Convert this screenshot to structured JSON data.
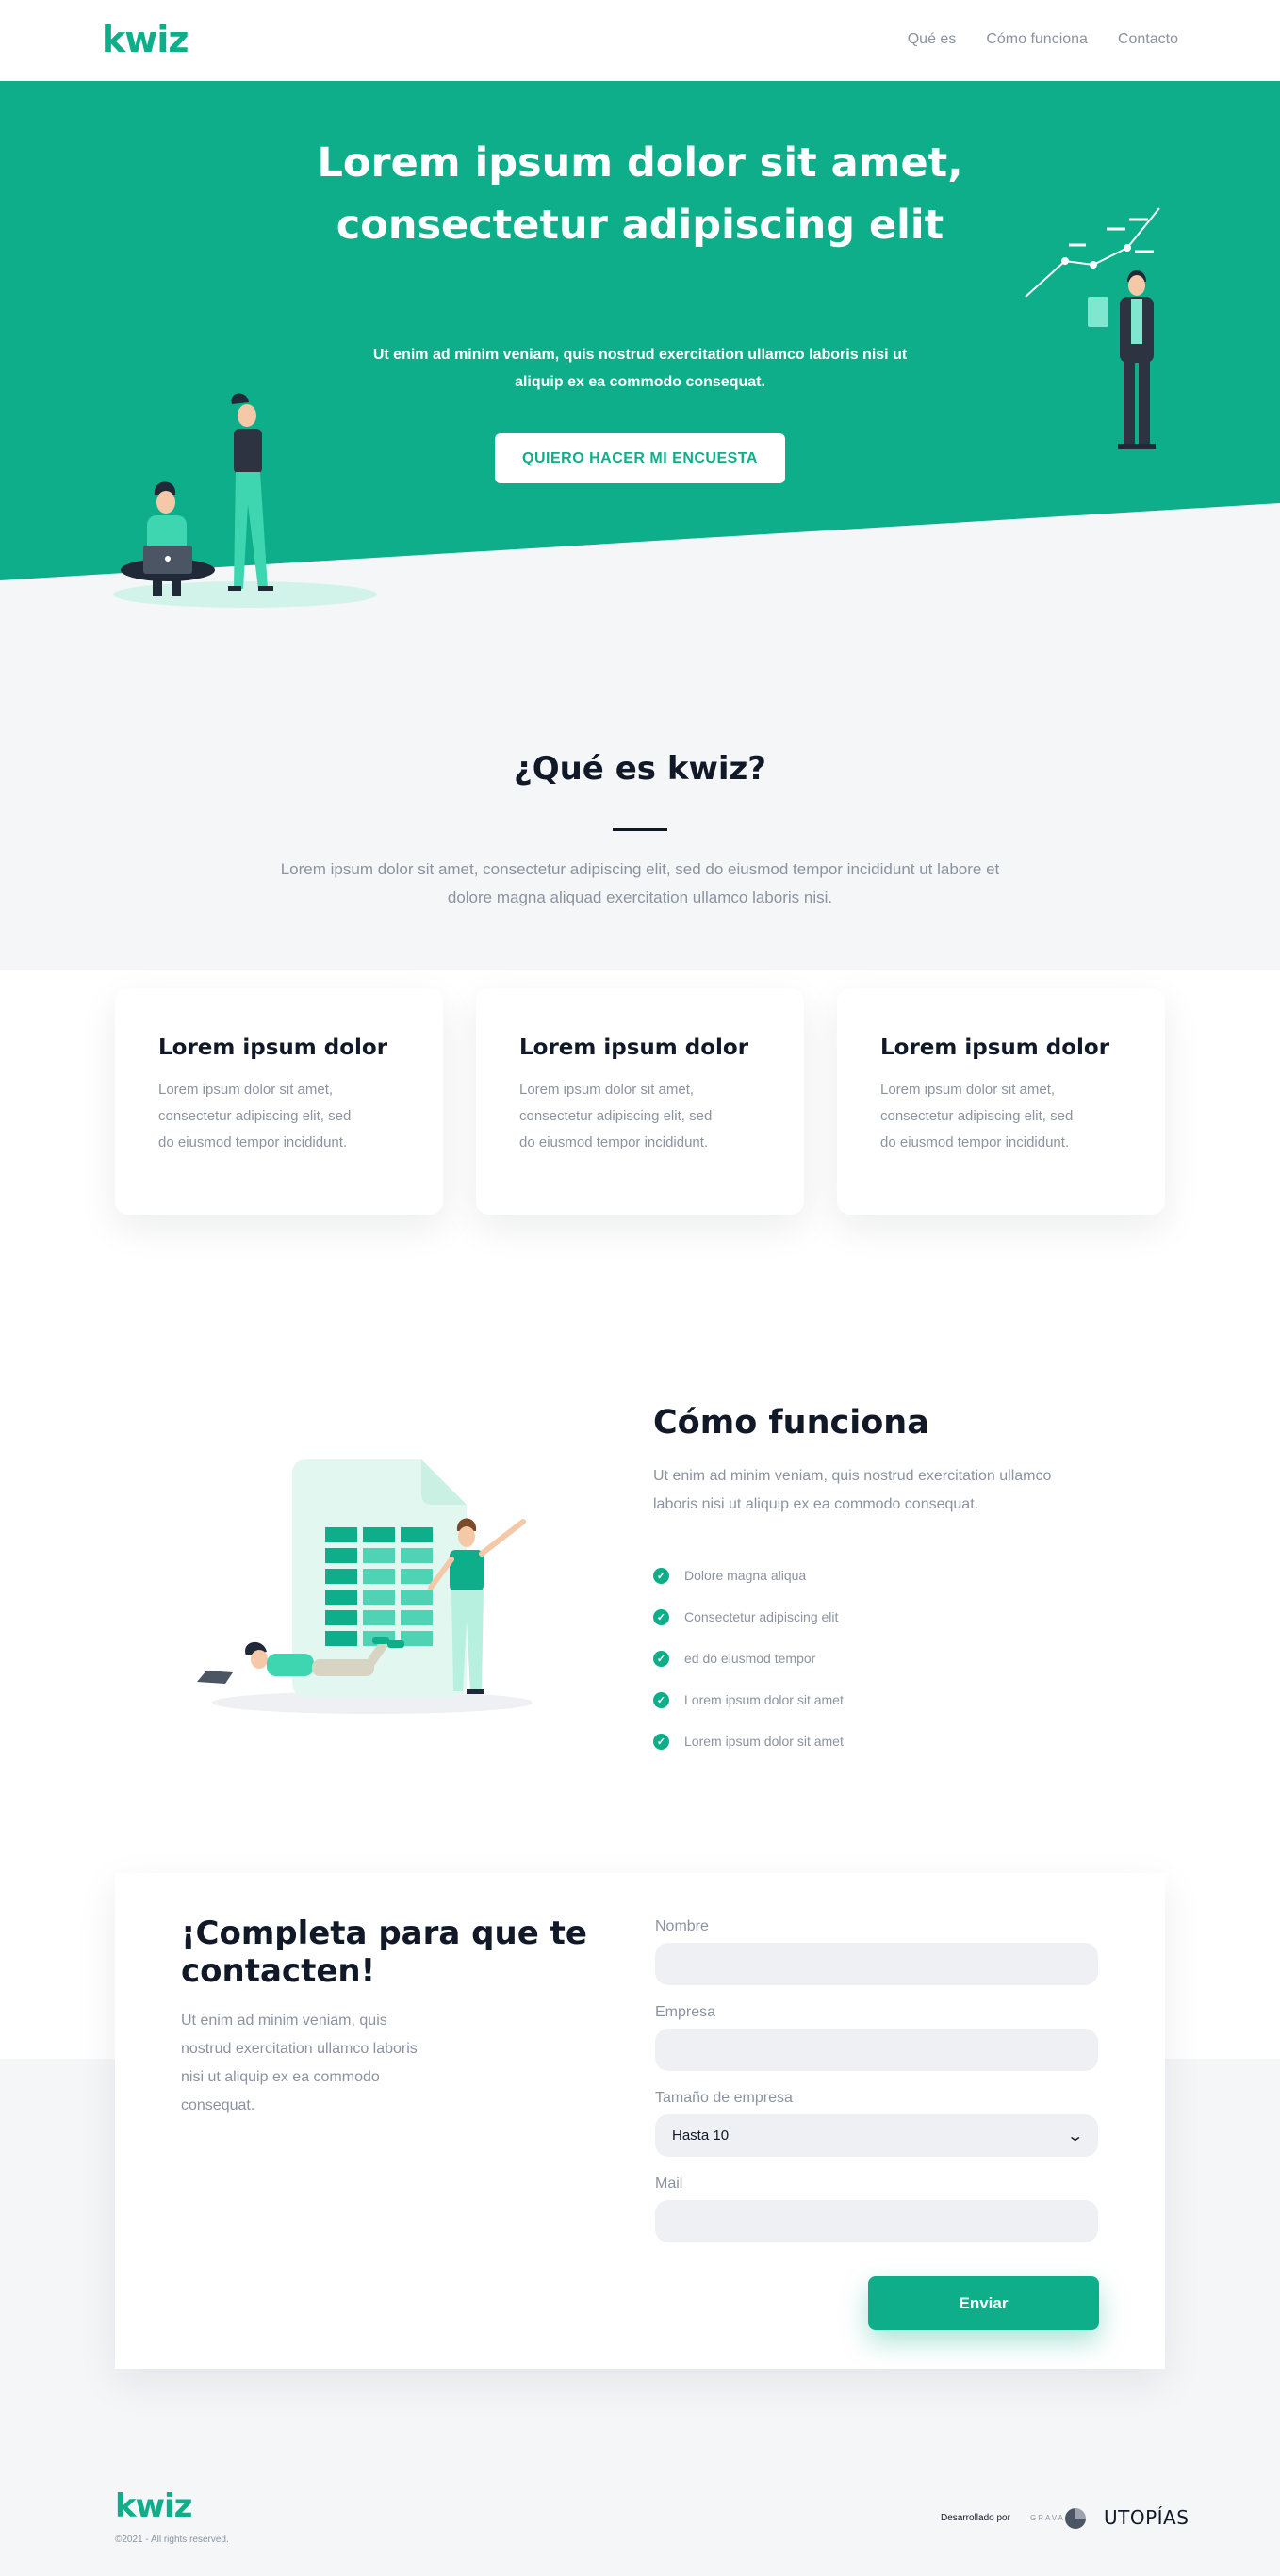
{
  "brand": {
    "name": "kwiz",
    "color": "#0fae8a"
  },
  "nav": {
    "links": [
      {
        "label": "Qué es"
      },
      {
        "label": "Cómo funciona"
      },
      {
        "label": "Contacto"
      }
    ]
  },
  "hero": {
    "title_line1": "Lorem ipsum dolor sit amet,",
    "title_line2": "consectetur adipiscing elit",
    "subtitle_line1": "Ut enim ad minim veniam, quis nostrud exercitation ullamco laboris nisi ut",
    "subtitle_line2": "aliquip ex ea commodo consequat.",
    "cta_label": "QUIERO HACER MI ENCUESTA"
  },
  "que_es": {
    "title": "¿Qué es kwiz?",
    "text_line1": "Lorem ipsum dolor sit amet, consectetur adipiscing elit, sed do eiusmod tempor incididunt ut labore et",
    "text_line2": "dolore magna aliquad exercitation ullamco laboris nisi."
  },
  "cards": [
    {
      "title": "Lorem ipsum dolor",
      "line1": "Lorem ipsum dolor sit amet,",
      "line2": "consectetur adipiscing elit, sed",
      "line3": "do eiusmod tempor incididunt."
    },
    {
      "title": "Lorem ipsum dolor",
      "line1": "Lorem ipsum dolor sit amet,",
      "line2": "consectetur adipiscing elit, sed",
      "line3": "do eiusmod tempor incididunt."
    },
    {
      "title": "Lorem ipsum dolor",
      "line1": "Lorem ipsum dolor sit amet,",
      "line2": "consectetur adipiscing elit, sed",
      "line3": "do eiusmod tempor incididunt."
    }
  ],
  "como_funciona": {
    "title": "Cómo funciona",
    "text_line1": "Ut enim ad minim veniam, quis nostrud exercitation ullamco",
    "text_line2": "laboris nisi ut aliquip ex ea commodo consequat.",
    "checklist": [
      "Dolore magna aliqua",
      "Consectetur adipiscing elit",
      "ed do eiusmod tempor",
      "Lorem ipsum dolor sit amet",
      "Lorem ipsum dolor sit amet"
    ]
  },
  "contact": {
    "title_line1": "¡Completa para que te",
    "title_line2": "contacten!",
    "text_line1": "Ut enim ad minim veniam, quis",
    "text_line2": "nostrud exercitation ullamco laboris",
    "text_line3": "nisi ut aliquip ex ea commodo",
    "text_line4": "consequat.",
    "fields": {
      "nombre_label": "Nombre",
      "nombre_value": "",
      "empresa_label": "Empresa",
      "empresa_value": "",
      "tamano_label": "Tamaño de empresa",
      "tamano_value": "Hasta 10",
      "mail_label": "Mail",
      "mail_value": ""
    },
    "submit_label": "Enviar"
  },
  "footer": {
    "logo": "kwiz",
    "copyright": "©2021 - All rights reserved.",
    "developed_by": "Desarrollado por",
    "partner1": "GRAVA",
    "partner2": "UTOPÍAS"
  }
}
